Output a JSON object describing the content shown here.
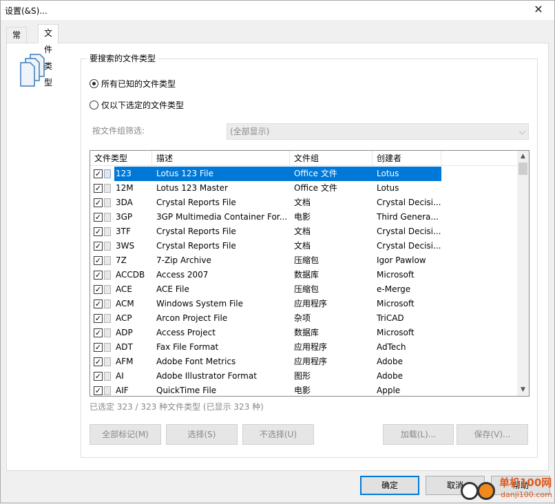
{
  "window": {
    "title": "设置(&S)..."
  },
  "tabs": [
    {
      "label": "常规"
    },
    {
      "label": "文件类型"
    }
  ],
  "group": {
    "legend": "要搜索的文件类型",
    "radio_all": "所有已知的文件类型",
    "radio_selected": "仅以下选定的文件类型",
    "filter_label": "按文件组筛选:",
    "filter_value": "(全部显示)"
  },
  "list": {
    "headers": [
      "文件类型",
      "描述",
      "文件组",
      "创建者"
    ],
    "rows": [
      {
        "type": "123",
        "desc": "Lotus 123 File",
        "group": "Office 文件",
        "creator": "Lotus",
        "checked": true,
        "selected": true
      },
      {
        "type": "12M",
        "desc": "Lotus 123 Master",
        "group": "Office 文件",
        "creator": "Lotus",
        "checked": true
      },
      {
        "type": "3DA",
        "desc": "Crystal Reports File",
        "group": "文档",
        "creator": "Crystal Decisi...",
        "checked": true
      },
      {
        "type": "3GP",
        "desc": "3GP Multimedia Container For...",
        "group": "电影",
        "creator": "Third Genera...",
        "checked": true
      },
      {
        "type": "3TF",
        "desc": "Crystal Reports File",
        "group": "文档",
        "creator": "Crystal Decisi...",
        "checked": true
      },
      {
        "type": "3WS",
        "desc": "Crystal Reports File",
        "group": "文档",
        "creator": "Crystal Decisi...",
        "checked": true
      },
      {
        "type": "7Z",
        "desc": "7-Zip Archive",
        "group": "压缩包",
        "creator": "Igor Pawlow",
        "checked": true
      },
      {
        "type": "ACCDB",
        "desc": "Access 2007",
        "group": "数据库",
        "creator": "Microsoft",
        "checked": true
      },
      {
        "type": "ACE",
        "desc": "ACE File",
        "group": "压缩包",
        "creator": "e-Merge",
        "checked": true
      },
      {
        "type": "ACM",
        "desc": "Windows System File",
        "group": "应用程序",
        "creator": "Microsoft",
        "checked": true
      },
      {
        "type": "ACP",
        "desc": "Arcon Project File",
        "group": "杂项",
        "creator": "TriCAD",
        "checked": true
      },
      {
        "type": "ADP",
        "desc": "Access Project",
        "group": "数据库",
        "creator": "Microsoft",
        "checked": true
      },
      {
        "type": "ADT",
        "desc": "Fax File Format",
        "group": "应用程序",
        "creator": "AdTech",
        "checked": true
      },
      {
        "type": "AFM",
        "desc": "Adobe Font Metrics",
        "group": "应用程序",
        "creator": "Adobe",
        "checked": true
      },
      {
        "type": "AI",
        "desc": "Adobe Illustrator Format",
        "group": "图形",
        "creator": "Adobe",
        "checked": true
      },
      {
        "type": "AIF",
        "desc": "QuickTime File",
        "group": "电影",
        "creator": "Apple",
        "checked": true
      }
    ]
  },
  "status_text": "已选定 323 / 323 种文件类型 (已显示 323 种)",
  "buttons": {
    "mark_all": "全部标记(M)",
    "select": "选择(S)",
    "deselect": "不选择(U)",
    "load": "加载(L)...",
    "save": "保存(V)...",
    "ok": "确定",
    "cancel": "取消",
    "help": "帮助"
  },
  "watermark": {
    "line1": "单机100网",
    "line2": "danji100.com"
  },
  "colors": {
    "selection": "#0078d7",
    "watermark": "#e05a1c"
  }
}
